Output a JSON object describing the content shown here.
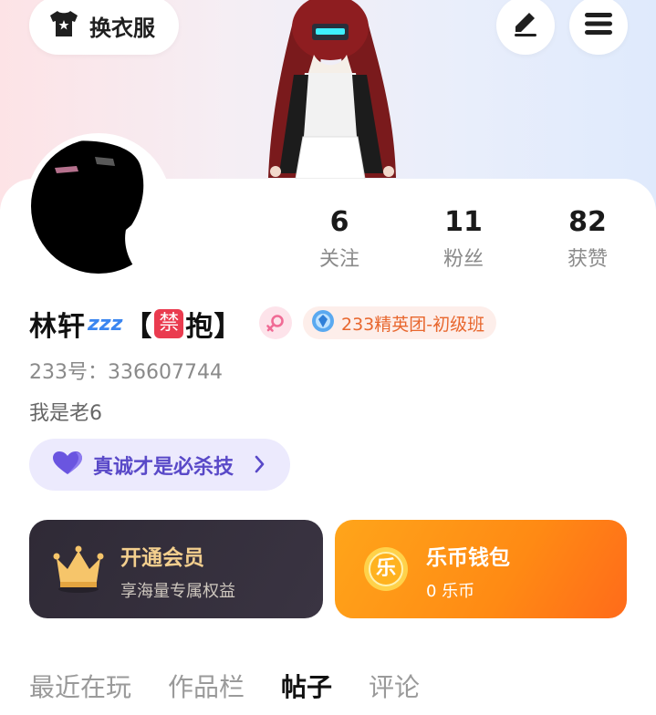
{
  "header": {
    "outfit_label": "换衣服",
    "outfit_icon": "tshirt-icon",
    "edit_icon": "pencil-icon",
    "menu_icon": "menu-icon"
  },
  "profile": {
    "name": "林轩",
    "name_suffix_open": "【",
    "name_ban_char": "禁",
    "name_suffix_close": "抱】",
    "zzz": "zzz",
    "gender_icon": "female-icon",
    "group_badge": "233精英团-初级班",
    "uid": "233号：336607744",
    "bio": "我是老6"
  },
  "stats": [
    {
      "value": "6",
      "label": "关注"
    },
    {
      "value": "11",
      "label": "粉丝"
    },
    {
      "value": "82",
      "label": "获赞"
    }
  ],
  "tag_pill": {
    "label": "真诚才是必杀技",
    "icon": "heart-icon"
  },
  "vip_card": {
    "title": "开通会员",
    "subtitle": "享海量专属权益",
    "icon": "crown-icon"
  },
  "wallet_card": {
    "title": "乐币钱包",
    "subtitle": "0 乐币",
    "coin_char": "乐",
    "icon": "coin-icon"
  },
  "tabs": [
    {
      "label": "最近在玩",
      "active": false
    },
    {
      "label": "作品栏",
      "active": false
    },
    {
      "label": "帖子",
      "active": true
    },
    {
      "label": "评论",
      "active": false
    }
  ],
  "colors": {
    "accent_purple": "#5949c8",
    "wallet_orange": "#ff8a14",
    "vip_gold": "#f3cf8e",
    "ban_red": "#ea3b4f"
  }
}
